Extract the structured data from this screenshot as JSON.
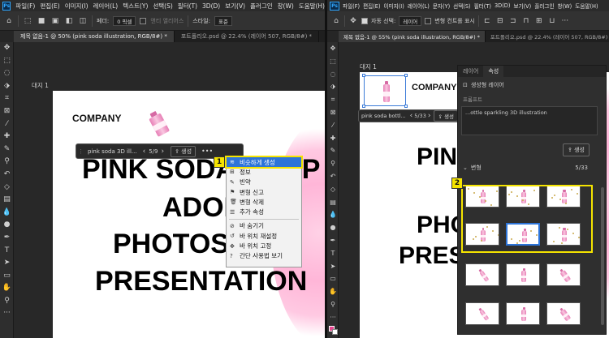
{
  "left": {
    "ps_logo": "Ps",
    "menu": [
      "파일(F)",
      "편집(E)",
      "이미지(I)",
      "레이어(L)",
      "텍스트(Y)",
      "선택(S)",
      "필터(T)",
      "3D(D)",
      "보기(V)",
      "플러그인",
      "창(W)",
      "도움말(H)"
    ],
    "options": {
      "feather_label": "페더:",
      "feather_value": "0 픽셀",
      "antialias_label": "앤티 앨리어스",
      "style_label": "스타일:",
      "style_value": "표준"
    },
    "tabs": [
      {
        "label": "제목 없음-1 @ 50% (pink soda illustration, RGB/8#) *",
        "active": true
      },
      {
        "label": "포트폴리오.psd @ 22.4% (레이어 507, RGB/8#) *",
        "active": false
      }
    ],
    "artboard_label": "대지 1",
    "company": "COMPANY",
    "headline": [
      "PINK SODA SHOP",
      "ADOBE",
      "PHOTOSHOP",
      "PRESENTATION"
    ],
    "genbar": {
      "prompt": "pink soda 3D ill...",
      "count": "5/9",
      "generate": "생성",
      "more": "•••"
    },
    "context_menu": [
      {
        "icon": "≋",
        "label": "비슷하게 생성",
        "highlight": true
      },
      {
        "icon": "⊞",
        "label": "정보"
      },
      {
        "icon": "✎",
        "label": "빈약"
      },
      {
        "icon": "⚑",
        "label": "변형 신고"
      },
      {
        "icon": "🗑",
        "label": "변형 삭제"
      },
      {
        "icon": "☰",
        "label": "추가 속성"
      },
      {
        "sep": true
      },
      {
        "icon": "⊘",
        "label": "바 숨기기"
      },
      {
        "icon": "↺",
        "label": "바 위치 재설정"
      },
      {
        "icon": "✥",
        "label": "바 위치 고정"
      },
      {
        "icon": "?",
        "label": "간단 사용법 보기"
      }
    ],
    "badge": "1"
  },
  "right": {
    "ps_logo": "Ps",
    "menu": [
      "파일(F)",
      "편집(E)",
      "이미지(I)",
      "레이어(L)",
      "문자(Y)",
      "선택(S)",
      "필터(T)",
      "3D(D)",
      "보기(V)",
      "플러그인",
      "창(W)",
      "도움말(H)"
    ],
    "options": {
      "autoselect_label": "자동 선택:",
      "autoselect_value": "레이어",
      "transform_label": "변형 컨트롤 표시"
    },
    "tabs": [
      {
        "label": "제목 없음-1 @ 55% (pink soda illustration, RGB/8#) *",
        "active": true
      },
      {
        "label": "포트폴리오.psd @ 22.4% (레이어 507, RGB/8#) *",
        "active": false
      }
    ],
    "artboard_label": "대지 1",
    "company": "COMPANY",
    "headline": [
      "PINK",
      "PHO",
      "PRES"
    ],
    "genbar": {
      "prompt": "pink soda bottl...",
      "count": "5/33",
      "generate": "생성",
      "more": "•••"
    },
    "panel": {
      "tabs": [
        "레이어",
        "속성"
      ],
      "layer_type": "생성형 레이어",
      "prompt_label": "프롬프트",
      "prompt_text": "...ottle sparkling 3D illustration",
      "generate_button": "생성",
      "variations_label": "변형",
      "variations_count": "5/33"
    },
    "badge": "2"
  }
}
